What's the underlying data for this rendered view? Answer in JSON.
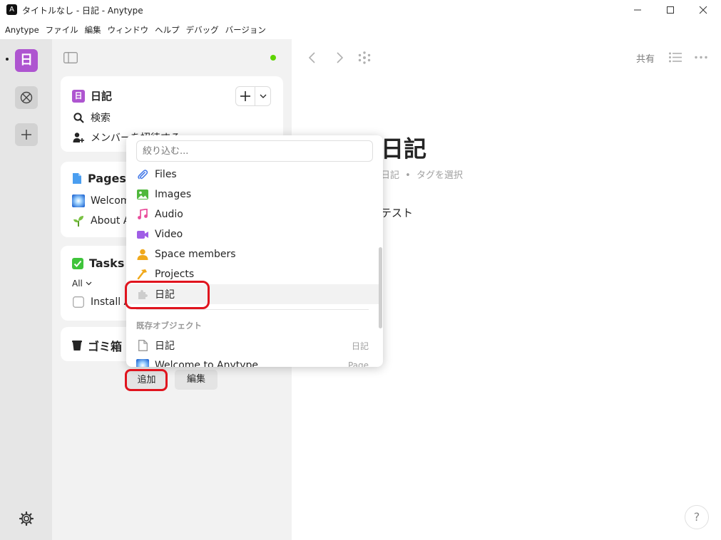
{
  "window": {
    "title": "タイトルなし - 日記 - Anytype",
    "app_icon": "A"
  },
  "menubar": [
    "Anytype",
    "ファイル",
    "編集",
    "ウィンドウ",
    "ヘルプ",
    "デバッグ",
    "バージョン"
  ],
  "rail": {
    "space_letter": "日"
  },
  "sidebar": {
    "space_card": {
      "title": "日記",
      "tile_letter": "日",
      "search": "検索",
      "invite": "メンバーを招待する"
    },
    "pages_card": {
      "title": "Pages",
      "items": [
        "Welcome to Anytype",
        "About Anytype"
      ]
    },
    "tasks_card": {
      "title": "Tasks",
      "filter": "All",
      "items": [
        "Install Anytype"
      ]
    },
    "trash_card": {
      "title": "ゴミ箱"
    },
    "add_button": "追加",
    "edit_button": "編集"
  },
  "main": {
    "share_label": "共有",
    "doc_title": "日記",
    "doc_meta_type": "日記",
    "doc_meta_sep": "•",
    "doc_meta_tags": "タグを選択",
    "doc_body": "テスト",
    "help": "?"
  },
  "popup": {
    "filter_placeholder": "絞り込む...",
    "types": [
      {
        "label": "Files",
        "icon": "paperclip-icon"
      },
      {
        "label": "Images",
        "icon": "image-icon"
      },
      {
        "label": "Audio",
        "icon": "music-note-icon"
      },
      {
        "label": "Video",
        "icon": "video-icon"
      },
      {
        "label": "Space members",
        "icon": "person-icon"
      },
      {
        "label": "Projects",
        "icon": "hammer-icon"
      },
      {
        "label": "日記",
        "icon": "puzzle-icon"
      }
    ],
    "section_label": "既存オブジェクト",
    "objects": [
      {
        "label": "日記",
        "type": "日記"
      },
      {
        "label": "Welcome to Anytype",
        "type": "Page"
      }
    ]
  },
  "colors": {
    "space_purple": "#ae55d0",
    "sync_green": "#5dd400",
    "highlight_red": "#e0141e"
  }
}
